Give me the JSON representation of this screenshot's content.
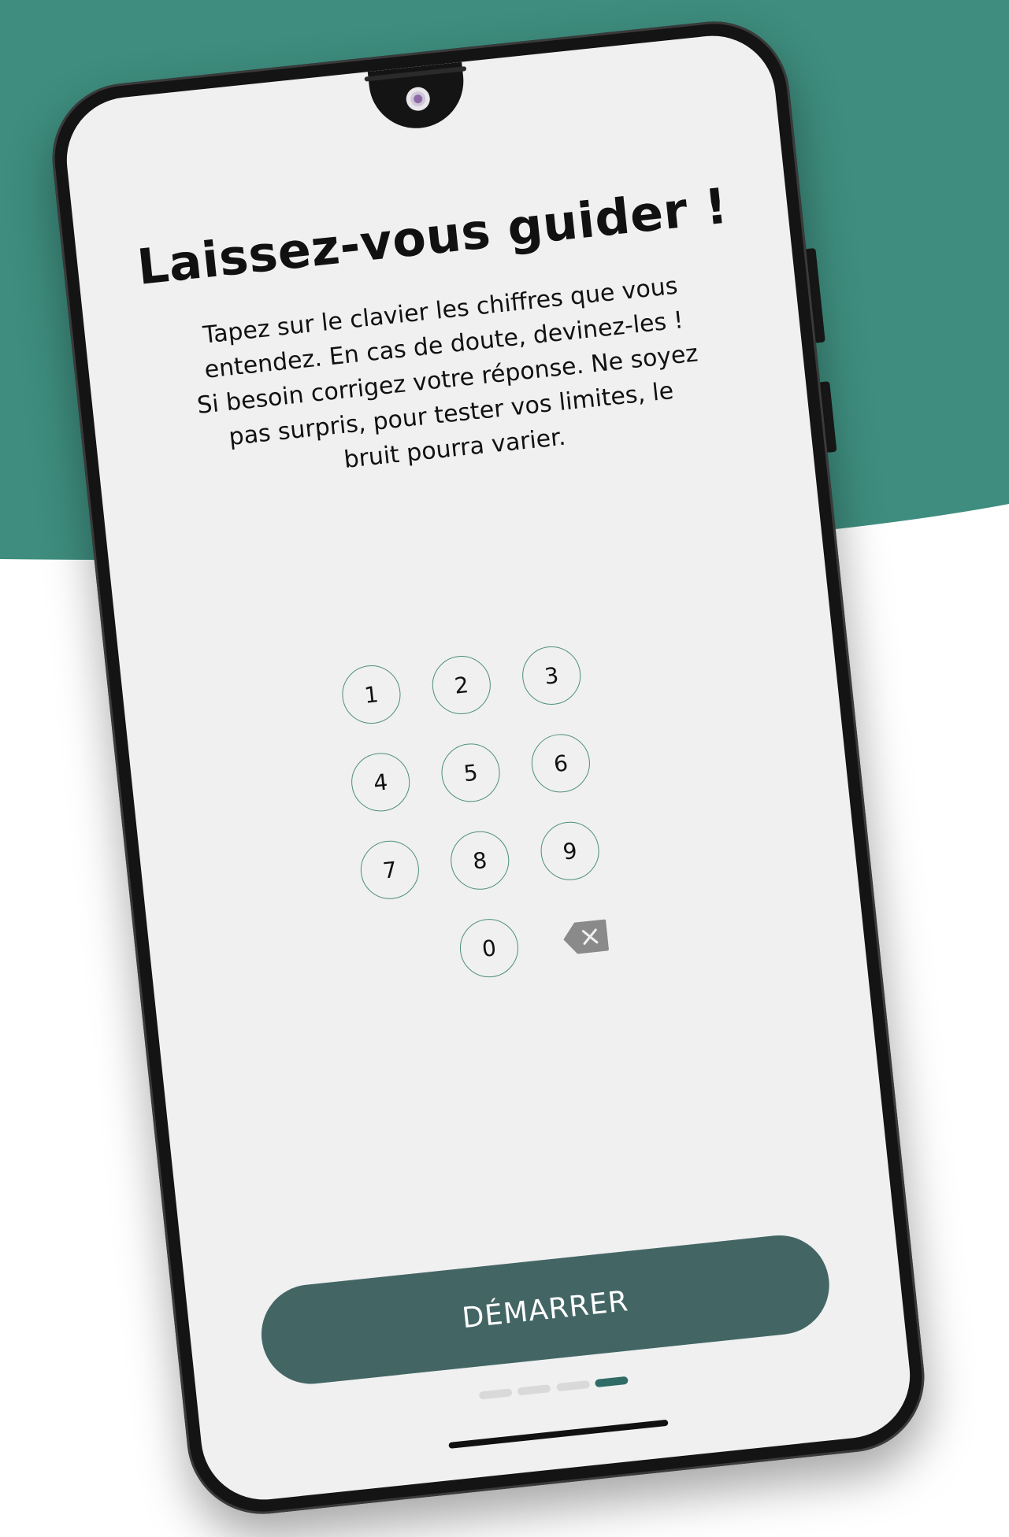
{
  "colors": {
    "background_teal": "#3e8d7e",
    "keypad_border": "#4e8f79",
    "button": "#436665",
    "active_dot": "#2f6c66"
  },
  "header": {
    "title": "Laissez-vous guider !"
  },
  "instructions": {
    "text": "Tapez sur le clavier les chiffres que vous entendez. En cas de doute, devinez-les ! Si besoin corrigez votre réponse. Ne soyez pas surpris, pour tester vos limites, le bruit pourra varier."
  },
  "keypad": {
    "keys": [
      "1",
      "2",
      "3",
      "4",
      "5",
      "6",
      "7",
      "8",
      "9",
      "0"
    ],
    "delete_icon": "backspace-icon"
  },
  "start_button": {
    "label": "DÉMARRER"
  },
  "pagination": {
    "total_pages": 4,
    "active_page": 4
  }
}
